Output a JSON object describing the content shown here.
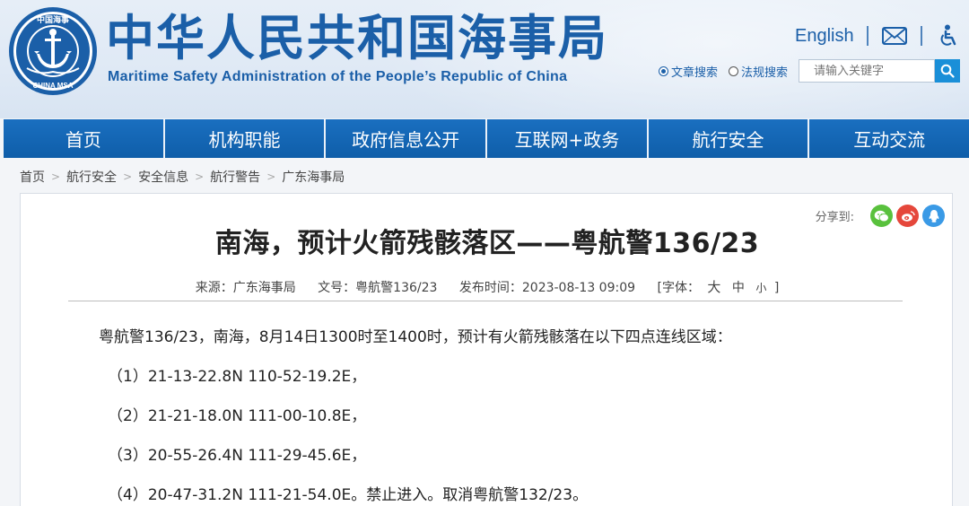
{
  "header": {
    "title_cn": "中华人民共和国海事局",
    "title_en": "Maritime Safety Administration of the People’s Republic of China",
    "emblem_top_text": "中国海事",
    "emblem_bottom_text": "CHINA MSA",
    "english_link": "English",
    "mail_icon": "mail-icon",
    "accessibility_icon": "accessibility-icon"
  },
  "search": {
    "option_article": "文章搜索",
    "option_regulation": "法规搜索",
    "selected": "文章搜索",
    "placeholder": "请输入关键字",
    "button_icon": "search-icon"
  },
  "nav": {
    "items": [
      "首页",
      "机构职能",
      "政府信息公开",
      "互联网+政务",
      "航行安全",
      "互动交流"
    ]
  },
  "breadcrumb": [
    "首页",
    "航行安全",
    "安全信息",
    "航行警告",
    "广东海事局"
  ],
  "share": {
    "label": "分享到:",
    "icons": [
      "wechat-icon",
      "weibo-icon",
      "qq-icon"
    ]
  },
  "article": {
    "title": "南海，预计火箭残骸落区——粤航警136/23",
    "source": "来源：广东海事局",
    "doc_no": "文号：粤航警136/23",
    "publish_time": "发布时间：2023-08-13 09:09",
    "font_label_open": "[字体：",
    "font_large": "大",
    "font_medium": "中",
    "font_small": "小",
    "font_label_close": "]",
    "paragraphs": [
      "粤航警136/23，南海，8月14日1300时至1400时，预计有火箭残骸落在以下四点连线区域：",
      "（1）21-13-22.8N 110-52-19.2E，",
      "（2）21-21-18.0N 111-00-10.8E，",
      "（3）20-55-26.4N 111-29-45.6E，",
      "（4）20-47-31.2N 111-21-54.0E。禁止进入。取消粤航警132/23。"
    ]
  },
  "colors": {
    "brand_blue": "#1b5fa8",
    "nav_blue": "#1264b3",
    "search_button": "#1a8fd8",
    "wechat": "#59c13d",
    "weibo": "#e5473b",
    "qq": "#3a9ae6"
  }
}
